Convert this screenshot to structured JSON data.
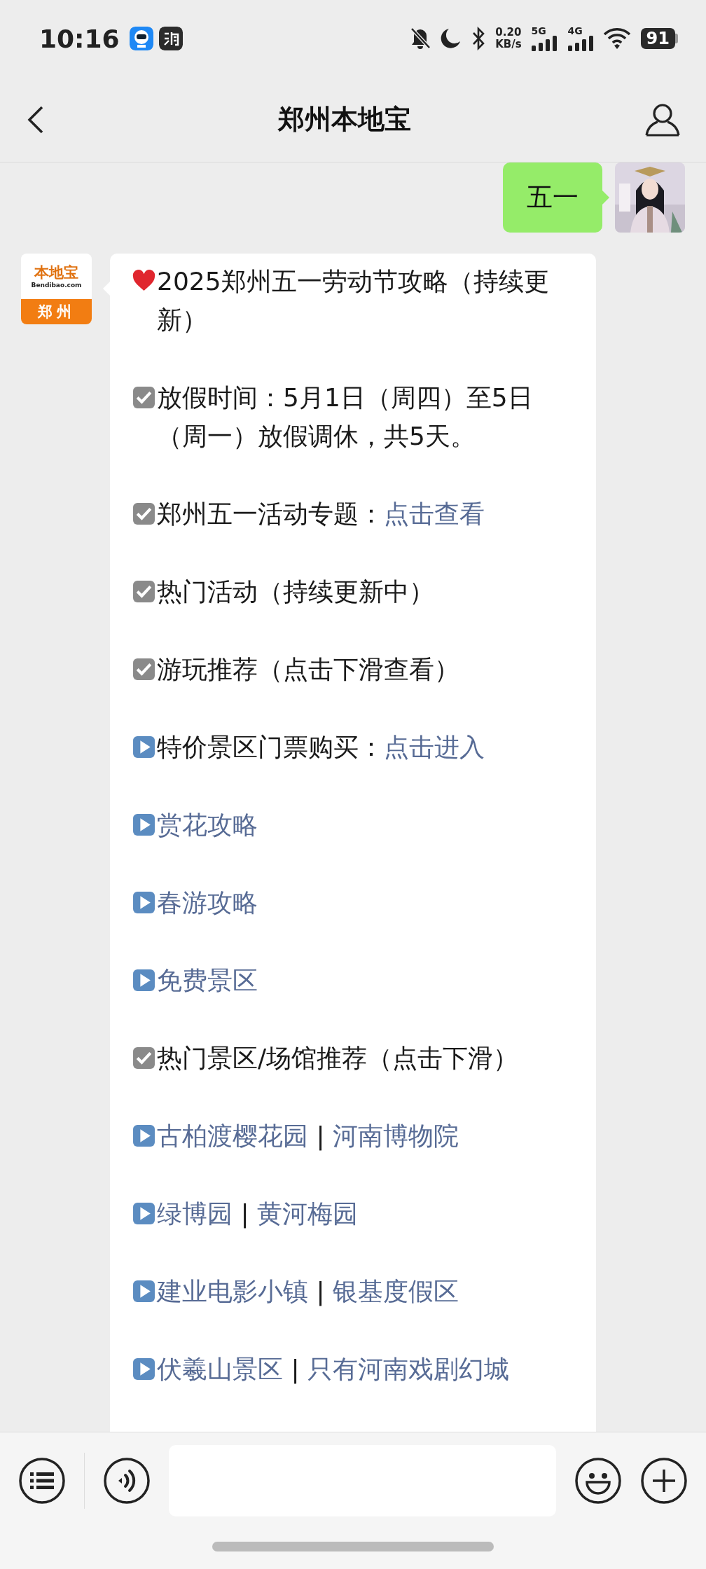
{
  "status_bar": {
    "time": "10:16",
    "net_speed": "0.20",
    "net_unit": "KB/s",
    "signal_labels": [
      "5G",
      "4G"
    ],
    "battery": "91"
  },
  "header": {
    "title": "郑州本地宝"
  },
  "messages": [
    {
      "kind": "sent",
      "text": "五一"
    },
    {
      "kind": "received",
      "sender_logo": {
        "name": "本地宝",
        "site": "Bendibao.com",
        "city": "郑州"
      },
      "paragraphs": [
        {
          "kind": "heart",
          "parts": [
            {
              "text": "2025郑州五一劳动节攻略（持续更新）",
              "link": false
            }
          ]
        },
        {
          "kind": "check",
          "parts": [
            {
              "text": "放假时间：5月1日（周四）至5日（周一）放假调休，共5天。",
              "link": false
            }
          ]
        },
        {
          "kind": "check",
          "parts": [
            {
              "text": "郑州五一活动专题：",
              "link": false
            },
            {
              "text": "点击查看",
              "link": true
            }
          ]
        },
        {
          "kind": "check",
          "parts": [
            {
              "text": "热门活动（持续更新中）",
              "link": false
            }
          ]
        },
        {
          "kind": "check",
          "parts": [
            {
              "text": "游玩推荐（点击下滑查看）",
              "link": false
            }
          ]
        },
        {
          "kind": "play",
          "parts": [
            {
              "text": "特价景区门票购买：",
              "link": false
            },
            {
              "text": "点击进入",
              "link": true
            }
          ]
        },
        {
          "kind": "play",
          "parts": [
            {
              "text": "赏花攻略",
              "link": true
            }
          ]
        },
        {
          "kind": "play",
          "parts": [
            {
              "text": "春游攻略",
              "link": true
            }
          ]
        },
        {
          "kind": "play",
          "parts": [
            {
              "text": "免费景区",
              "link": true
            }
          ]
        },
        {
          "kind": "check",
          "parts": [
            {
              "text": "热门景区/场馆推荐（点击下滑）",
              "link": false
            }
          ]
        },
        {
          "kind": "play",
          "parts": [
            {
              "text": "古柏渡樱花园",
              "link": true
            },
            {
              "text": " | ",
              "link": false
            },
            {
              "text": "河南博物院",
              "link": true
            }
          ]
        },
        {
          "kind": "play",
          "parts": [
            {
              "text": "绿博园",
              "link": true
            },
            {
              "text": " | ",
              "link": false
            },
            {
              "text": "黄河梅园",
              "link": true
            }
          ]
        },
        {
          "kind": "play",
          "parts": [
            {
              "text": "建业电影小镇",
              "link": true
            },
            {
              "text": " | ",
              "link": false
            },
            {
              "text": "银基度假区",
              "link": true
            }
          ]
        },
        {
          "kind": "play",
          "parts": [
            {
              "text": "伏羲山景区",
              "link": true
            },
            {
              "text": " | ",
              "link": false
            },
            {
              "text": "只有河南戏剧幻城",
              "link": true
            }
          ]
        }
      ]
    }
  ]
}
